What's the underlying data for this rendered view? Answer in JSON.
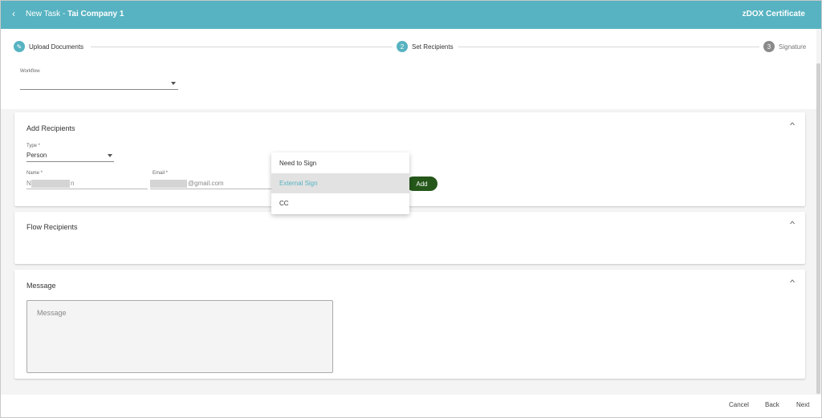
{
  "header": {
    "back_icon": "chevron-left-icon",
    "title_prefix": "New Task - ",
    "title_company": "Tai Company 1",
    "brand": "zDOX Certificate",
    "color": "#57b3c1"
  },
  "stepper": {
    "steps": [
      {
        "label": "Upload Documents",
        "badge": "✎",
        "icon": "pencil-icon",
        "state": "completed"
      },
      {
        "label": "Set Recipients",
        "badge": "2",
        "state": "active"
      },
      {
        "label": "Signature",
        "badge": "3",
        "state": "inactive"
      }
    ]
  },
  "workflow": {
    "label": "Workflow",
    "value": ""
  },
  "add_recipients": {
    "title": "Add Recipients",
    "type_label": "Type *",
    "type_value": "Person",
    "name_label": "Name *",
    "name_value_start": "N",
    "name_value_end": "n",
    "email_label": "Email *",
    "email_value_end": "@gmail.com",
    "add_button": "Add",
    "add_button_color": "#245719"
  },
  "role_dropdown": {
    "options": [
      "Need to Sign",
      "External Sign",
      "CC"
    ],
    "highlighted": "External Sign"
  },
  "flow_recipients": {
    "title": "Flow Recipients"
  },
  "message": {
    "title": "Message",
    "placeholder": "Message"
  },
  "footer": {
    "cancel": "Cancel",
    "back": "Back",
    "next": "Next"
  }
}
